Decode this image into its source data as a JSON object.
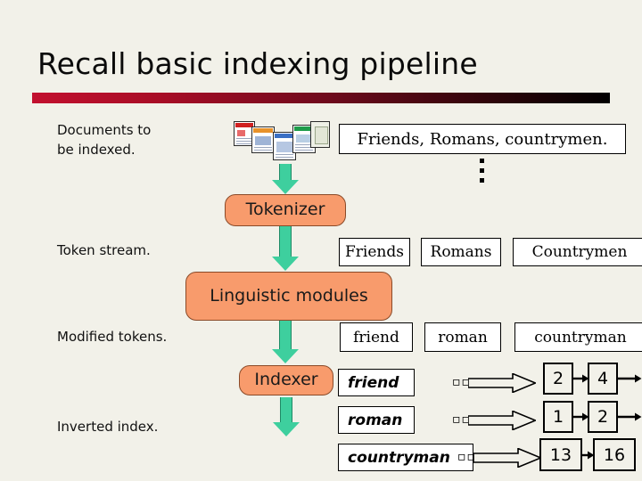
{
  "slide": {
    "title": "Recall basic indexing pipeline",
    "accent_start": "#c2102e",
    "accent_end": "#000000",
    "background": "#f2f1e9",
    "process_fill": "#f89b6c",
    "arrow_fill": "#3ecf9e"
  },
  "labels": {
    "documents": "Documents to\nbe indexed.",
    "token_stream": "Token stream.",
    "modified_tokens": "Modified tokens.",
    "inverted_index": "Inverted index."
  },
  "processes": {
    "tokenizer": "Tokenizer",
    "linguistic_modules": "Linguistic\nmodules",
    "indexer": "Indexer"
  },
  "input": {
    "sentence": "Friends, Romans, countrymen.",
    "ellipsis": "⋮",
    "doc_icons": [
      "document-icon-red",
      "document-icon-orange",
      "document-icon-blue",
      "document-icon-green",
      "document-icon-plain"
    ]
  },
  "token_stream": {
    "tokens": [
      "Friends",
      "Romans",
      "Countrymen"
    ]
  },
  "modified_tokens": {
    "tokens": [
      "friend",
      "roman",
      "countryman"
    ]
  },
  "inverted_index": {
    "entries": [
      {
        "term": "friend",
        "glyphs": "▫▫",
        "postings": [
          "2",
          "4"
        ]
      },
      {
        "term": "roman",
        "glyphs": "▫▫",
        "postings": [
          "1",
          "2"
        ]
      },
      {
        "term": "countryman",
        "glyphs": "▫▫",
        "postings": [
          "13",
          "16"
        ]
      }
    ]
  }
}
